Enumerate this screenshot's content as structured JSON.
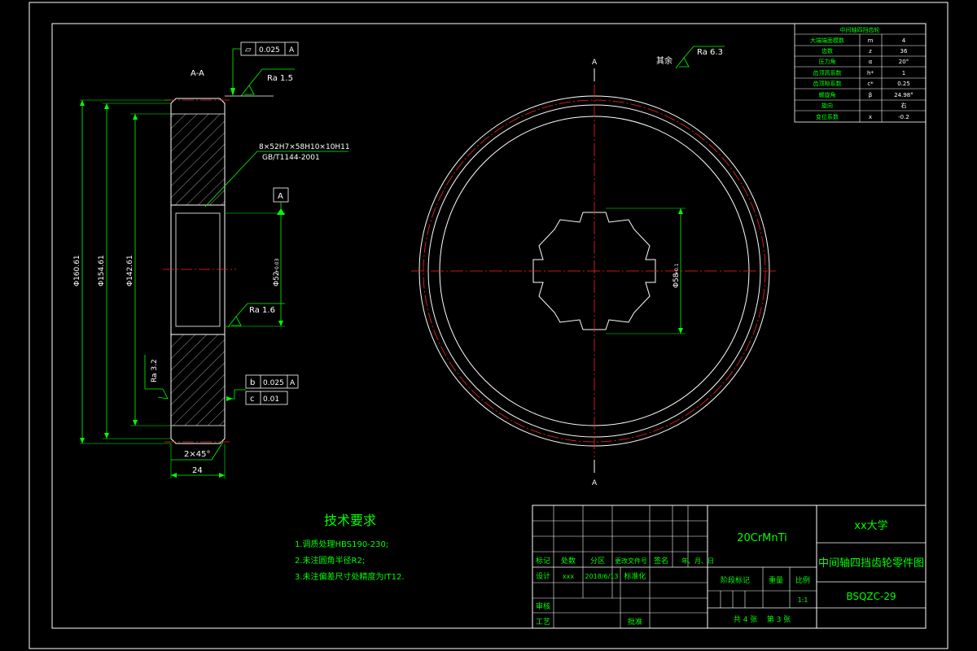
{
  "section": {
    "label": "A-A",
    "flatness": {
      "symbol": "⏥",
      "tolerance": "0.025",
      "datum": "A"
    },
    "ra_top": "Ra 1.5",
    "spline_spec_1": "8×52H7×58H10×10H11",
    "spline_spec_2": "GB/T1144-2001",
    "datum_label": "A",
    "bore_dim": "Φ52",
    "bore_tol": "+0.03",
    "ra_bore": "Ra 1.6",
    "ra_side": "Ra 3.2",
    "dia_outer": "Φ160.61",
    "dia_mid": "Φ154.61",
    "dia_inner": "Φ142.61",
    "runout_1": {
      "symbol": "b",
      "tolerance": "0.025",
      "datum": "A"
    },
    "runout_2": {
      "symbol": "c",
      "tolerance": "0.01"
    },
    "chamfer": "2×45°",
    "width": "24"
  },
  "front_view": {
    "section_mark_top": "A",
    "section_mark_bottom": "A",
    "other_label": "其余",
    "ra_other": "Ra 6.3",
    "spline_dim": "Φ58",
    "spline_tol": "+0.1"
  },
  "gear_params": {
    "title": "中间轴四挡齿轮",
    "rows": [
      {
        "name": "大端端面模数",
        "symbol": "m",
        "value": "4"
      },
      {
        "name": "齿数",
        "symbol": "z",
        "value": "36"
      },
      {
        "name": "压力角",
        "symbol": "α",
        "value": "20°"
      },
      {
        "name": "齿顶高系数",
        "symbol": "h*",
        "value": "1"
      },
      {
        "name": "齿顶隙系数",
        "symbol": "c*",
        "value": "0.25"
      },
      {
        "name": "螺旋角",
        "symbol": "β",
        "value": "24.98°"
      },
      {
        "name": "旋向",
        "symbol": "",
        "value": "右"
      },
      {
        "name": "变位系数",
        "symbol": "x",
        "value": "-0.2"
      }
    ]
  },
  "tech_req": {
    "title": "技术要求",
    "items": [
      "1.调质处理HBS190-230;",
      "2.未注圆角半径R2;",
      "3.未注偏差尺寸处精度为IT12."
    ]
  },
  "title_block": {
    "material": "20CrMnTi",
    "school": "xx大学",
    "part_name": "中间轴四挡齿轮零件图",
    "drawing_no": "BSQZC-29",
    "header_cells": [
      "标记",
      "处数",
      "分区",
      "更改文件号",
      "签名",
      "年、月、日"
    ],
    "design_label": "设计",
    "designer": "xxx",
    "date": "2018/6/13",
    "std_label": "标准化",
    "stage_label": "阶段标记",
    "weight_label": "重量",
    "scale_label": "比例",
    "scale": "1:1",
    "review_label": "审核",
    "process_label": "工艺",
    "approve_label": "批准",
    "sheet_info": "共 4 张    第 3 张"
  }
}
